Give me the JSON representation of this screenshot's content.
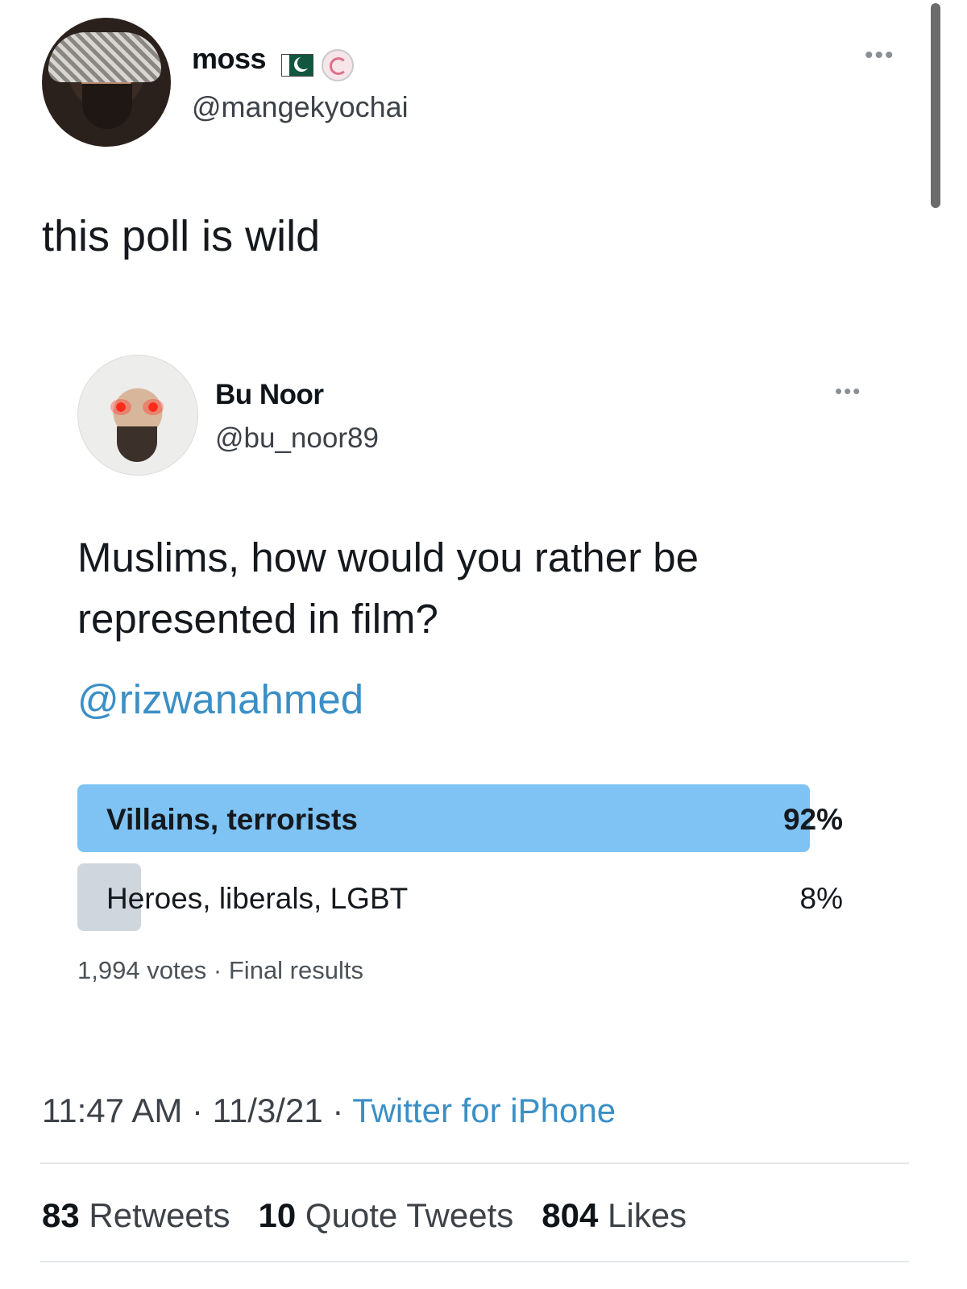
{
  "tweet": {
    "author": {
      "name": "moss",
      "handle": "@mangekyochai"
    },
    "more_icon": "more-icon",
    "text": "this poll is wild",
    "quoted": {
      "author": {
        "name": "Bu Noor",
        "handle": "@bu_noor89"
      },
      "text_line1": "Muslims, how would you rather be",
      "text_line2": "represented in film?",
      "mention": "@rizwanahmed",
      "poll": {
        "options": [
          {
            "label": "Villains, terrorists",
            "percent_label": "92%",
            "percent": 92,
            "leading": true
          },
          {
            "label": "Heroes, liberals, LGBT",
            "percent_label": "8%",
            "percent": 8,
            "leading": false
          }
        ],
        "votes": "1,994 votes",
        "separator": "·",
        "status": "Final results"
      }
    },
    "timestamp": "11:47 AM · 11/3/21 · ",
    "source": "Twitter for iPhone",
    "stats": {
      "retweets_count": "83",
      "retweets_label": " Retweets",
      "quotes_count": "10",
      "quotes_label": " Quote Tweets",
      "likes_count": "804",
      "likes_label": " Likes"
    }
  },
  "colors": {
    "accent": "#3a8fc6",
    "poll_winner": "#7ec3f3",
    "poll_other": "#cfd6dd"
  }
}
